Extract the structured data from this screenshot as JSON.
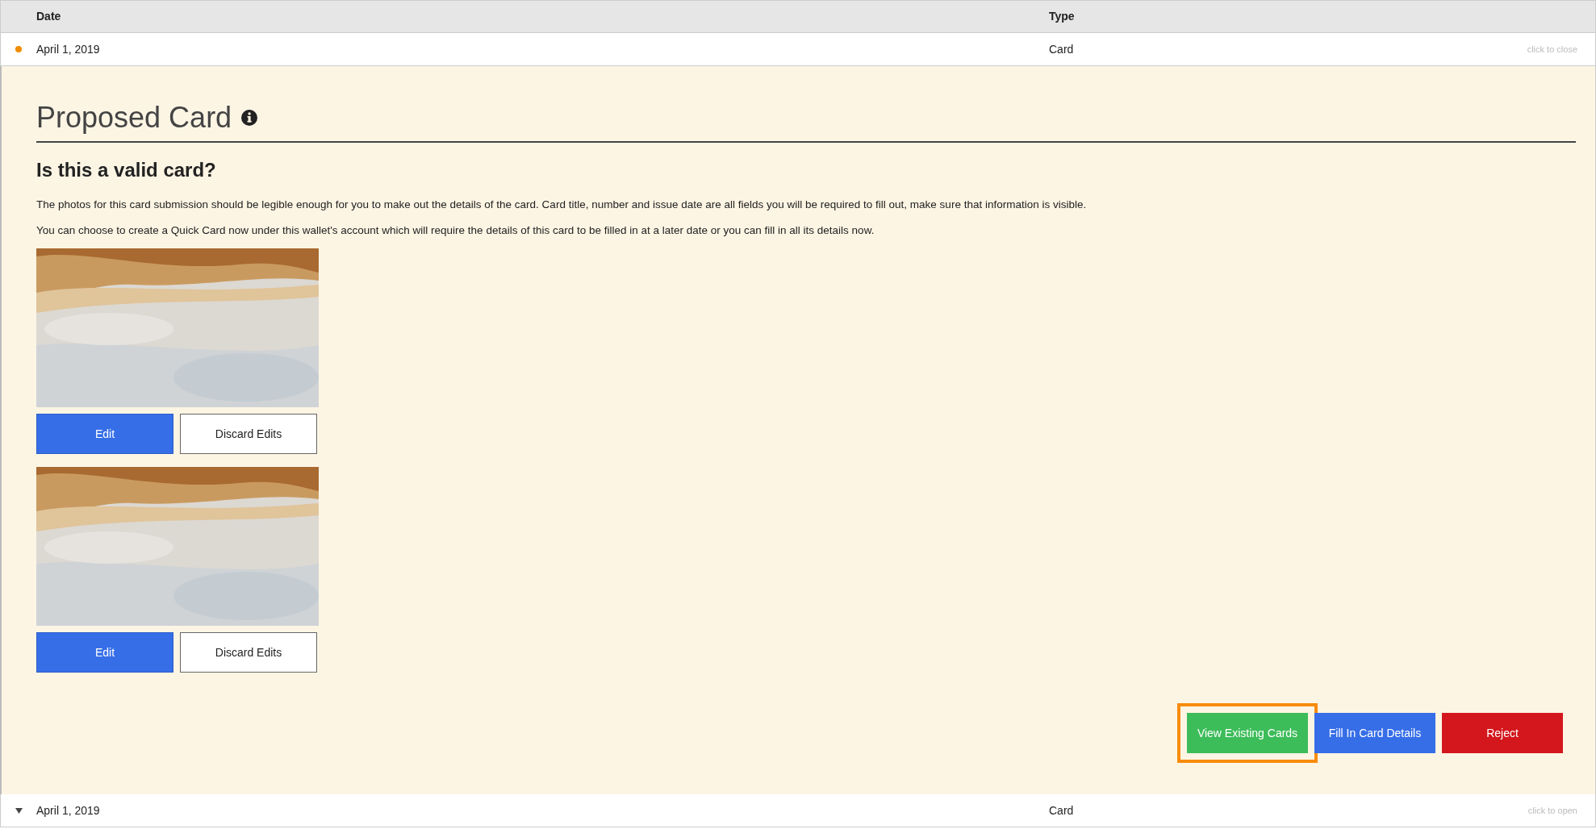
{
  "table": {
    "columns": [
      "Date",
      "Type"
    ],
    "rows": [
      {
        "date": "April 1, 2019",
        "type": "Card",
        "hint": "click to close",
        "expanded": true
      },
      {
        "date": "April 1, 2019",
        "type": "Card",
        "hint": "click to open",
        "expanded": false
      }
    ]
  },
  "panel": {
    "title": "Proposed Card",
    "question": "Is this a valid card?",
    "paragraphs": [
      "The photos for this card submission should be legible enough for you to make out the details of the card. Card title, number and issue date are all fields you will be required to fill out, make sure that information is visible.",
      "You can choose to create a Quick Card now under this wallet's account which will require the details of this card to be filled in at a later date or you can fill in all its details now."
    ],
    "photos": [
      {
        "kind": "picture",
        "buttons": [
          "Edit",
          "Discard Edits"
        ]
      },
      {
        "kind": "picture",
        "buttons": [
          "Edit",
          "Discard Edits"
        ]
      }
    ],
    "actions": [
      {
        "label": "View Existing Cards",
        "kind": "success",
        "highlighted": true
      },
      {
        "label": "Fill In Card Details",
        "kind": "primary",
        "highlighted": false
      },
      {
        "label": "Reject",
        "kind": "danger",
        "highlighted": false
      }
    ]
  }
}
